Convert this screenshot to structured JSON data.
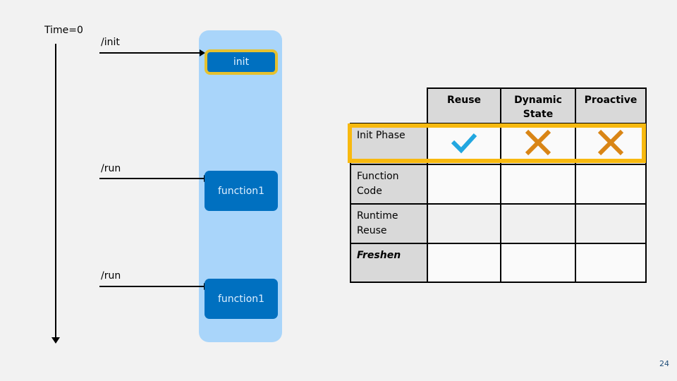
{
  "timeline": {
    "label": "Time=0"
  },
  "requests": [
    {
      "label": "/init"
    },
    {
      "label": "/run"
    },
    {
      "label": "/run"
    }
  ],
  "boxes": {
    "init": "init",
    "function_a": "function1",
    "function_b": "function1"
  },
  "matrix": {
    "columns": [
      "Reuse",
      "Dynamic State",
      "Proactive"
    ],
    "rows": [
      {
        "label": "Init Phase",
        "values": [
          "check",
          "cross",
          "cross"
        ]
      },
      {
        "label": "Function Code",
        "values": [
          "",
          "",
          ""
        ]
      },
      {
        "label": "Runtime Reuse",
        "values": [
          "",
          "",
          ""
        ]
      },
      {
        "label": "Freshen",
        "values": [
          "",
          "",
          ""
        ]
      }
    ]
  },
  "colors": {
    "check": "#22a7e0",
    "cross": "#d98515",
    "highlight": "#f8b90f",
    "function_box": "#0070c0",
    "container": "#a9d5fa"
  },
  "footer": {
    "page_number": "24"
  }
}
